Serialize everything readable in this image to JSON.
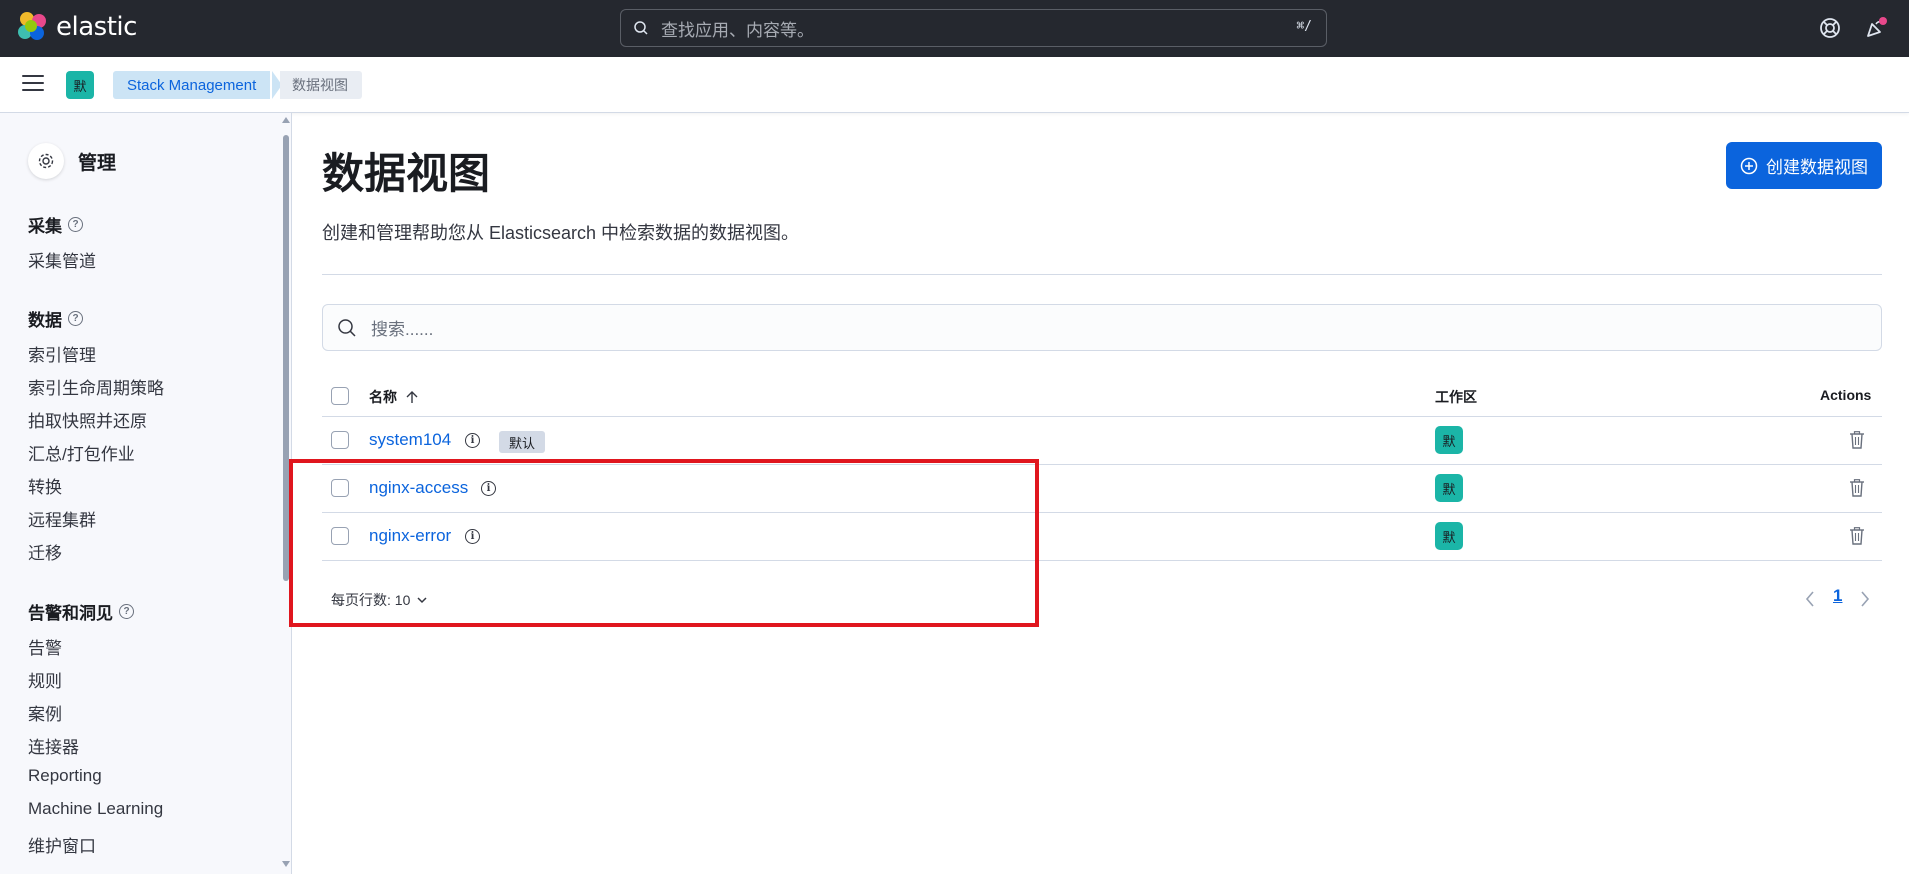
{
  "header": {
    "brand": "elastic",
    "search_placeholder": "查找应用、内容等。",
    "search_shortcut": "⌘/",
    "brand_colors": [
      "#f0b92b",
      "#e8488b",
      "#3ebeb0",
      "#0b64dd",
      "#93c90e"
    ]
  },
  "subheader": {
    "space_badge": "默",
    "breadcrumbs": [
      "Stack Management",
      "数据视图"
    ]
  },
  "sidebar": {
    "title": "管理",
    "groups": [
      {
        "label": "采集",
        "items": [
          "采集管道"
        ]
      },
      {
        "label": "数据",
        "items": [
          "索引管理",
          "索引生命周期策略",
          "拍取快照并还原",
          "汇总/打包作业",
          "转换",
          "远程集群",
          "迁移"
        ]
      },
      {
        "label": "告警和洞见",
        "items": [
          "告警",
          "规则",
          "案例",
          "连接器",
          "Reporting",
          "Machine Learning",
          "维护窗口"
        ]
      }
    ]
  },
  "main": {
    "title": "数据视图",
    "description": "创建和管理帮助您从 Elasticsearch 中检索数据的数据视图。",
    "create_button": "创建数据视图",
    "search_placeholder": "搜索......",
    "columns": {
      "name": "名称",
      "workspace": "工作区",
      "actions": "Actions"
    },
    "rows": [
      {
        "name": "system104",
        "badge": "默认",
        "space": "默"
      },
      {
        "name": "nginx-access",
        "space": "默"
      },
      {
        "name": "nginx-error",
        "space": "默"
      }
    ],
    "rows_per_page": "每页行数: 10",
    "current_page": "1"
  },
  "colors": {
    "accent": "#0b64dd",
    "space_badge": "#1bb5a7",
    "highlight": "#e0161e",
    "header_bg": "#25282f"
  }
}
